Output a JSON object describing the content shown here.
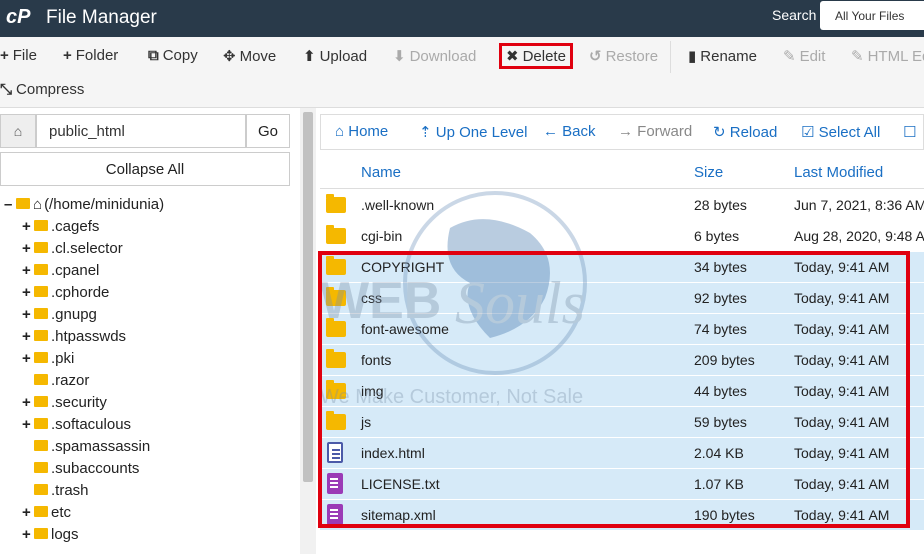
{
  "app": {
    "logo": "cP",
    "title": "File Manager",
    "search_label": "Search",
    "search_select": "All Your Files"
  },
  "toolbar": {
    "file": "File",
    "folder": "Folder",
    "copy": "Copy",
    "move": "Move",
    "upload": "Upload",
    "download": "Download",
    "delete": "Delete",
    "restore": "Restore",
    "rename": "Rename",
    "edit": "Edit",
    "html_editor": "HTML Ed",
    "compress": "Compress"
  },
  "left": {
    "path_value": "public_html",
    "go": "Go",
    "collapse_all": "Collapse All"
  },
  "tree": [
    {
      "label": "(/home/minidunia)",
      "toggle": "–",
      "root": true
    },
    {
      "label": ".cagefs",
      "toggle": "+"
    },
    {
      "label": ".cl.selector",
      "toggle": "+"
    },
    {
      "label": ".cpanel",
      "toggle": "+"
    },
    {
      "label": ".cphorde",
      "toggle": "+"
    },
    {
      "label": ".gnupg",
      "toggle": "+"
    },
    {
      "label": ".htpasswds",
      "toggle": "+"
    },
    {
      "label": ".pki",
      "toggle": "+"
    },
    {
      "label": ".razor",
      "toggle": ""
    },
    {
      "label": ".security",
      "toggle": "+"
    },
    {
      "label": ".softaculous",
      "toggle": "+"
    },
    {
      "label": ".spamassassin",
      "toggle": ""
    },
    {
      "label": ".subaccounts",
      "toggle": ""
    },
    {
      "label": ".trash",
      "toggle": ""
    },
    {
      "label": "etc",
      "toggle": "+"
    },
    {
      "label": "logs",
      "toggle": "+"
    }
  ],
  "nav": {
    "home": "Home",
    "up": "Up One Level",
    "back": "Back",
    "forward": "Forward",
    "reload": "Reload",
    "select_all": "Select All"
  },
  "columns": {
    "name": "Name",
    "size": "Size",
    "modified": "Last Modified"
  },
  "files": [
    {
      "name": ".well-known",
      "size": "28 bytes",
      "modified": "Jun 7, 2021, 8:36 AM",
      "type": "folder",
      "selected": false
    },
    {
      "name": "cgi-bin",
      "size": "6 bytes",
      "modified": "Aug 28, 2020, 9:48 A",
      "type": "folder",
      "selected": false
    },
    {
      "name": "COPYRIGHT",
      "size": "34 bytes",
      "modified": "Today, 9:41 AM",
      "type": "folder",
      "selected": true
    },
    {
      "name": "css",
      "size": "92 bytes",
      "modified": "Today, 9:41 AM",
      "type": "folder",
      "selected": true
    },
    {
      "name": "font-awesome",
      "size": "74 bytes",
      "modified": "Today, 9:41 AM",
      "type": "folder",
      "selected": true
    },
    {
      "name": "fonts",
      "size": "209 bytes",
      "modified": "Today, 9:41 AM",
      "type": "folder",
      "selected": true
    },
    {
      "name": "img",
      "size": "44 bytes",
      "modified": "Today, 9:41 AM",
      "type": "folder",
      "selected": true
    },
    {
      "name": "js",
      "size": "59 bytes",
      "modified": "Today, 9:41 AM",
      "type": "folder",
      "selected": true
    },
    {
      "name": "index.html",
      "size": "2.04 KB",
      "modified": "Today, 9:41 AM",
      "type": "html",
      "selected": true
    },
    {
      "name": "LICENSE.txt",
      "size": "1.07 KB",
      "modified": "Today, 9:41 AM",
      "type": "text",
      "selected": true
    },
    {
      "name": "sitemap.xml",
      "size": "190 bytes",
      "modified": "Today, 9:41 AM",
      "type": "text",
      "selected": true
    }
  ],
  "watermark": {
    "brand_a": "WEB",
    "brand_b": "Souls",
    "tagline": "We Make Customer, Not Sale"
  }
}
